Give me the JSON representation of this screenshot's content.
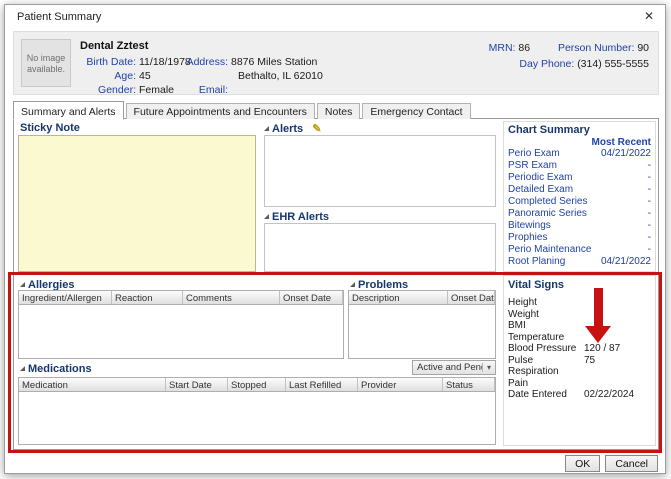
{
  "window": {
    "title": "Patient Summary",
    "close_glyph": "✕"
  },
  "patient": {
    "no_image_text": "No image available.",
    "name": "Dental Zztest",
    "fields": {
      "birth_date": {
        "label": "Birth Date:",
        "value": "11/18/1978"
      },
      "age": {
        "label": "Age:",
        "value": "45"
      },
      "gender": {
        "label": "Gender:",
        "value": "Female"
      },
      "address": {
        "label": "Address:",
        "value": "8876 Miles Station",
        "value2": "Bethalto, IL 62010"
      },
      "email": {
        "label": "Email:",
        "value": ""
      },
      "mrn": {
        "label": "MRN:",
        "value": "86"
      },
      "person_number": {
        "label": "Person Number:",
        "value": "90"
      },
      "day_phone": {
        "label": "Day Phone:",
        "value": "(314) 555-5555"
      }
    }
  },
  "tabs": [
    {
      "label": "Summary and Alerts",
      "active": true
    },
    {
      "label": "Future Appointments and Encounters",
      "active": false
    },
    {
      "label": "Notes",
      "active": false
    },
    {
      "label": "Emergency Contact",
      "active": false
    }
  ],
  "sticky_note": {
    "title": "Sticky Note",
    "content": ""
  },
  "alerts": {
    "title": "Alerts",
    "edit_icon": "✎",
    "content": ""
  },
  "ehr_alerts": {
    "title": "EHR Alerts",
    "content": ""
  },
  "chart_summary": {
    "title": "Chart Summary",
    "column_header": "Most Recent",
    "rows": [
      {
        "label": "Perio Exam",
        "value": "04/21/2022"
      },
      {
        "label": "PSR Exam",
        "value": "-"
      },
      {
        "label": "Periodic Exam",
        "value": "-"
      },
      {
        "label": "Detailed Exam",
        "value": "-"
      },
      {
        "label": "Completed Series",
        "value": "-"
      },
      {
        "label": "Panoramic Series",
        "value": "-"
      },
      {
        "label": "Bitewings",
        "value": "-"
      },
      {
        "label": "Prophies",
        "value": "-"
      },
      {
        "label": "Perio Maintenance",
        "value": "-"
      },
      {
        "label": "Root Planing",
        "value": "04/21/2022"
      }
    ]
  },
  "allergies": {
    "title": "Allergies",
    "columns": [
      "Ingredient/Allergen",
      "Reaction",
      "Comments",
      "Onset Date"
    ],
    "rows": []
  },
  "problems": {
    "title": "Problems",
    "columns": [
      "Description",
      "Onset Date"
    ],
    "rows": []
  },
  "vital_signs": {
    "title": "Vital Signs",
    "rows": [
      {
        "label": "Height",
        "value": ""
      },
      {
        "label": "Weight",
        "value": ""
      },
      {
        "label": "BMI",
        "value": ""
      },
      {
        "label": "Temperature",
        "value": ""
      },
      {
        "label": "Blood Pressure",
        "value": "120 / 87"
      },
      {
        "label": "Pulse",
        "value": "75"
      },
      {
        "label": "Respiration",
        "value": ""
      },
      {
        "label": "Pain",
        "value": ""
      },
      {
        "label": "Date Entered",
        "value": "02/22/2024"
      }
    ]
  },
  "medications": {
    "title": "Medications",
    "filter": {
      "value": "Active and Pending",
      "arrow_glyph": "▾"
    },
    "columns": [
      "Medication",
      "Start Date",
      "Stopped",
      "Last Refilled",
      "Provider",
      "Status"
    ],
    "rows": []
  },
  "buttons": {
    "ok": "OK",
    "cancel": "Cancel"
  },
  "annotation": {
    "highlight_color": "#C81111",
    "arrow_color": "#C81111",
    "arrow_points_to": "Blood Pressure / Pulse values"
  },
  "colors": {
    "label_blue": "#2142A6",
    "header_navy": "#16366E",
    "sticky_yellow": "#FBF9D0"
  }
}
